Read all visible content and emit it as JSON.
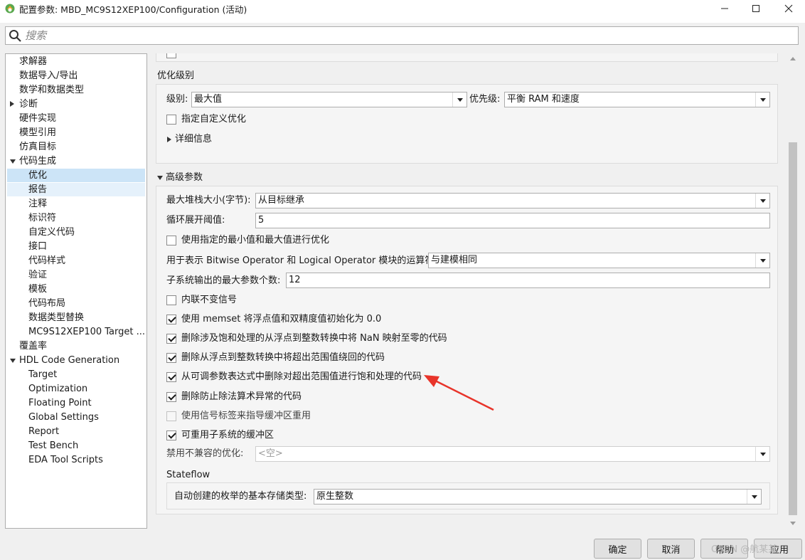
{
  "window": {
    "title": "配置参数: MBD_MC9S12XEP100/Configuration (活动)",
    "controls": [
      "minimize-icon",
      "maximize-icon",
      "close-icon"
    ]
  },
  "search": {
    "placeholder": "搜索"
  },
  "tree": {
    "items": [
      {
        "label": "求解器",
        "level": 0
      },
      {
        "label": "数据导入/导出",
        "level": 0
      },
      {
        "label": "数学和数据类型",
        "level": 0
      },
      {
        "label": "诊断",
        "level": 0,
        "expander": "collapsed"
      },
      {
        "label": "硬件实现",
        "level": 0
      },
      {
        "label": "模型引用",
        "level": 0
      },
      {
        "label": "仿真目标",
        "level": 0
      },
      {
        "label": "代码生成",
        "level": 0,
        "expander": "expanded"
      },
      {
        "label": "优化",
        "level": 1,
        "state": "selected"
      },
      {
        "label": "报告",
        "level": 1,
        "state": "hover"
      },
      {
        "label": "注释",
        "level": 1
      },
      {
        "label": "标识符",
        "level": 1
      },
      {
        "label": "自定义代码",
        "level": 1
      },
      {
        "label": "接口",
        "level": 1
      },
      {
        "label": "代码样式",
        "level": 1
      },
      {
        "label": "验证",
        "level": 1
      },
      {
        "label": "模板",
        "level": 1
      },
      {
        "label": "代码布局",
        "level": 1
      },
      {
        "label": "数据类型替换",
        "level": 1
      },
      {
        "label": "MC9S12XEP100 Target ...",
        "level": 1
      },
      {
        "label": "覆盖率",
        "level": 0
      },
      {
        "label": "HDL Code Generation",
        "level": 0,
        "expander": "expanded"
      },
      {
        "label": "Target",
        "level": 1
      },
      {
        "label": "Optimization",
        "level": 1
      },
      {
        "label": "Floating Point",
        "level": 1
      },
      {
        "label": "Global Settings",
        "level": 1
      },
      {
        "label": "Report",
        "level": 1
      },
      {
        "label": "Test Bench",
        "level": 1
      },
      {
        "label": "EDA Tool Scripts",
        "level": 1
      }
    ]
  },
  "optimization_level": {
    "heading": "优化级别",
    "level_label": "级别:",
    "level_value": "最大值",
    "priority_label": "优先级:",
    "priority_value": "平衡 RAM 和速度",
    "custom_opt_label": "指定自定义优化",
    "custom_opt_checked": false,
    "details_label": "详细信息"
  },
  "advanced": {
    "heading": "高级参数",
    "max_stack_label": "最大堆栈大小(字节):",
    "max_stack_value": "从目标继承",
    "loop_unroll_label": "循环展开阈值:",
    "loop_unroll_value": "5",
    "minmax_label": "使用指定的最小值和最大值进行优化",
    "minmax_checked": false,
    "bitwise_label": "用于表示 Bitwise Operator 和 Logical Operator 模块的运算符:",
    "bitwise_value": "与建模相同",
    "max_args_label": "子系统输出的最大参数个数:",
    "max_args_value": "12",
    "checkboxes": [
      {
        "label": "内联不变信号",
        "checked": false,
        "enabled": true
      },
      {
        "label": "使用 memset 将浮点值和双精度值初始化为 0.0",
        "checked": true,
        "enabled": true
      },
      {
        "label": "删除涉及饱和处理的从浮点到整数转换中将 NaN 映射至零的代码",
        "checked": true,
        "enabled": true
      },
      {
        "label": "删除从浮点到整数转换中将超出范围值绕回的代码",
        "checked": true,
        "enabled": true
      },
      {
        "label": "从可调参数表达式中删除对超出范围值进行饱和处理的代码",
        "checked": true,
        "enabled": true
      },
      {
        "label": "删除防止除法算术异常的代码",
        "checked": true,
        "enabled": true
      },
      {
        "label": "使用信号标签来指导缓冲区重用",
        "checked": false,
        "enabled": false
      },
      {
        "label": "可重用子系统的缓冲区",
        "checked": true,
        "enabled": true
      }
    ],
    "disable_incompat_label": "禁用不兼容的优化:",
    "disable_incompat_value": "<空>"
  },
  "stateflow": {
    "heading": "Stateflow",
    "enum_storage_label": "自动创建的枚举的基本存储类型:",
    "enum_storage_value": "原生整数"
  },
  "buttons": {
    "ok": "确定",
    "cancel": "取消",
    "help": "帮助",
    "apply": "应用"
  },
  "watermark": "CSDN @航某某",
  "colors": {
    "selection": "#cce4f7",
    "hover": "#e5f1fb",
    "annotation_arrow": "#e8342a"
  }
}
